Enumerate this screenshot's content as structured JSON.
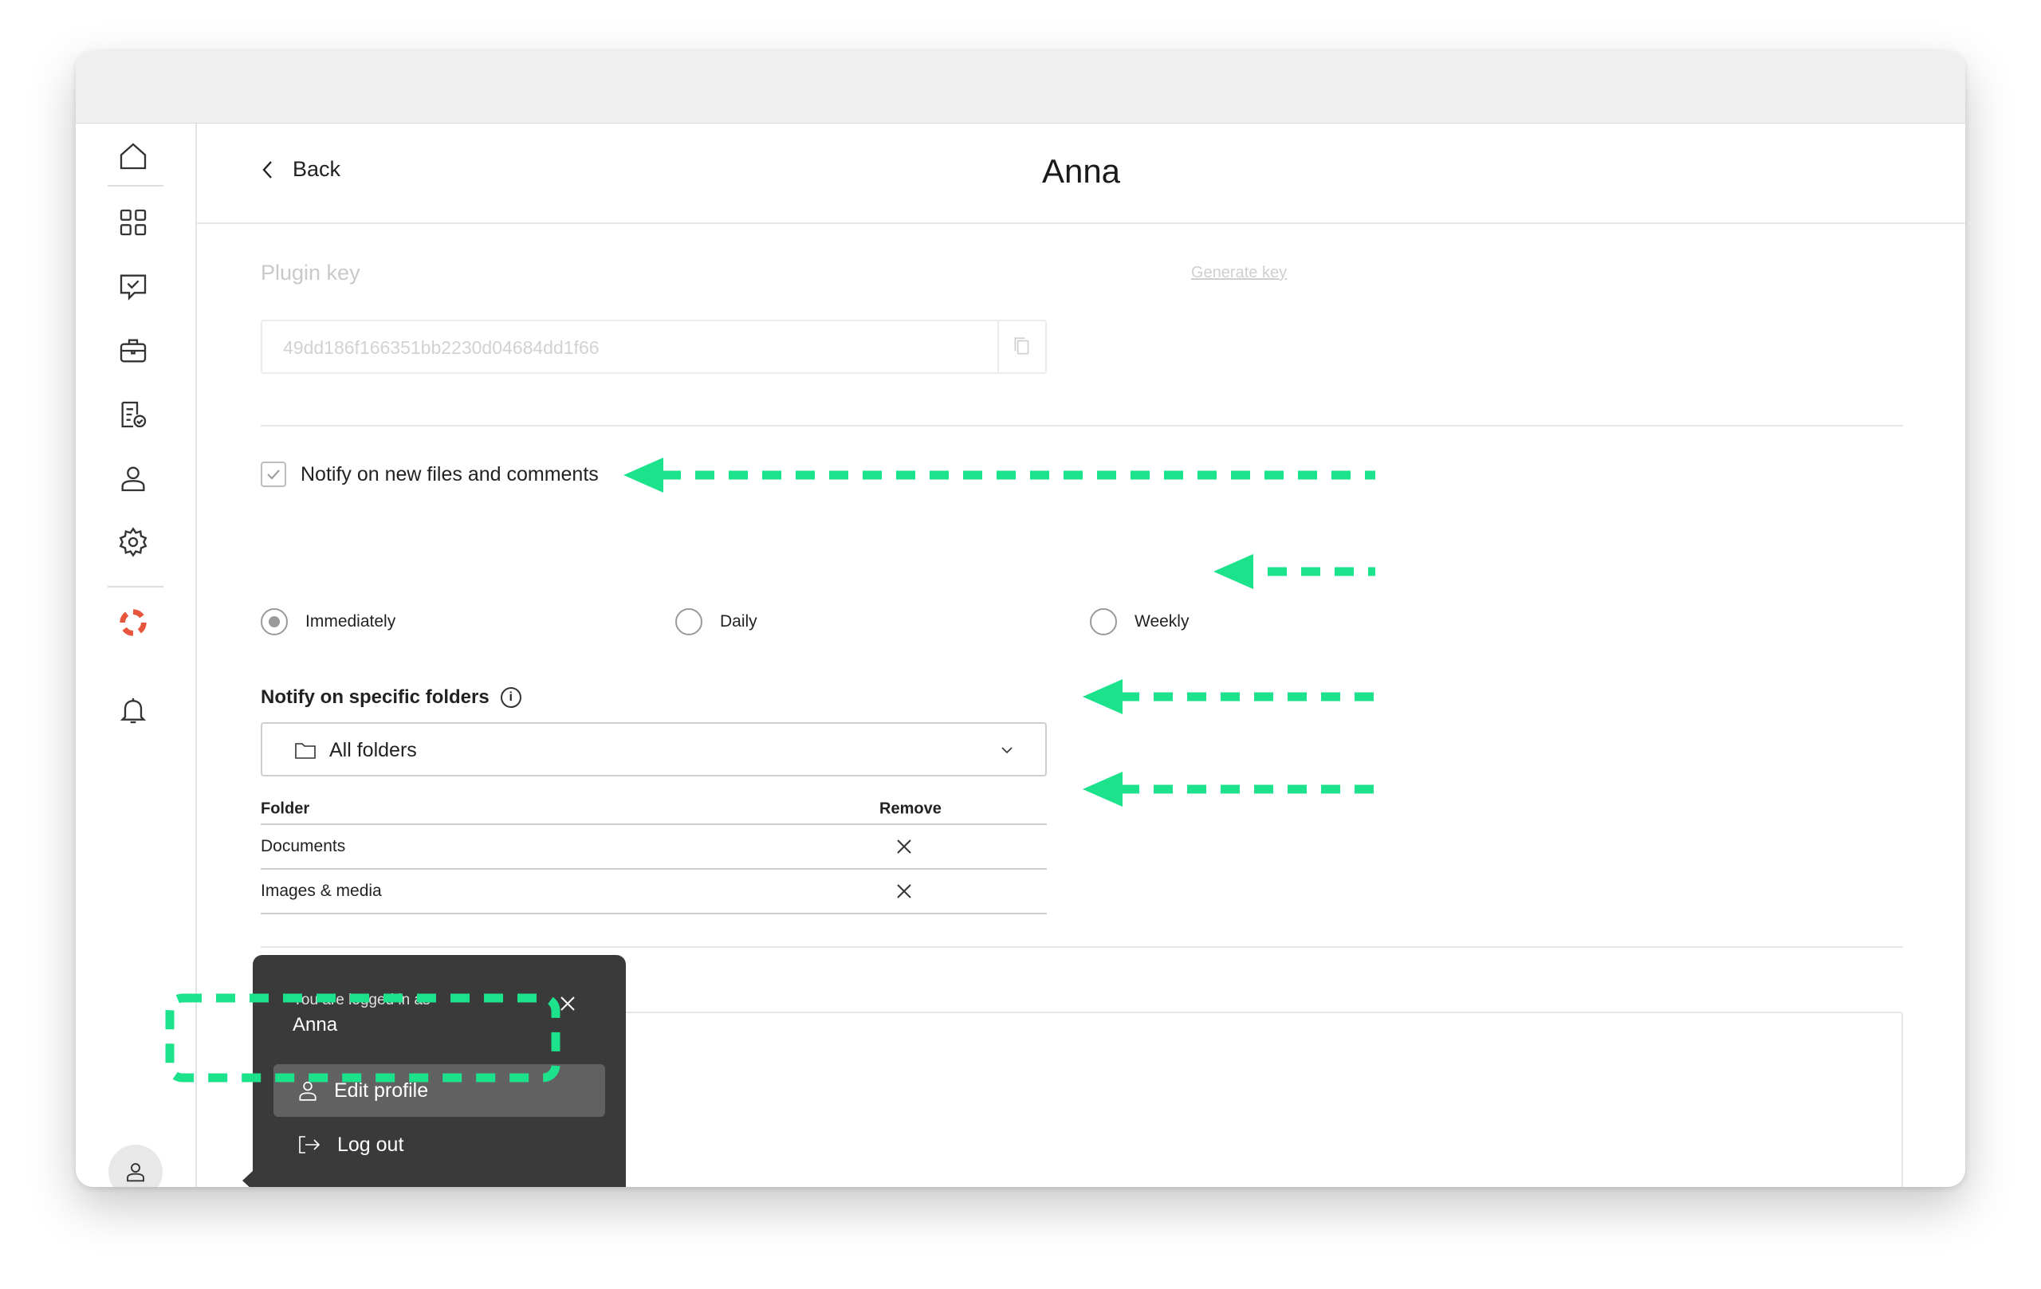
{
  "header": {
    "back_label": "Back",
    "title": "Anna"
  },
  "sidebar": {
    "icons": [
      "home-icon",
      "grid-icon",
      "chat-check-icon",
      "briefcase-icon",
      "document-check-icon",
      "person-icon",
      "gear-icon",
      "lifebuoy-icon",
      "bell-icon",
      "avatar-icon"
    ]
  },
  "plugin": {
    "label": "Plugin key",
    "generate_label": "Generate key",
    "key_value": "49dd186f166351bb2230d04684dd1f66"
  },
  "notify": {
    "checkbox_label": "Notify on new files and comments",
    "checked": true,
    "frequency": [
      {
        "label": "Immediately",
        "selected": true
      },
      {
        "label": "Daily",
        "selected": false
      },
      {
        "label": "Weekly",
        "selected": false
      }
    ]
  },
  "folders": {
    "label": "Notify on specific folders",
    "info_symbol": "i",
    "select_value": "All folders",
    "table": {
      "columns": [
        "Folder",
        "Remove"
      ],
      "rows": [
        {
          "folder": "Documents"
        },
        {
          "folder": "Images & media"
        }
      ]
    }
  },
  "popup": {
    "caption": "You are logged in as",
    "user": "Anna",
    "edit_label": "Edit profile",
    "logout_label": "Log out"
  },
  "colors": {
    "annotation_green": "#1de28c",
    "popup_bg": "#3a3a3a",
    "lifebuoy_red": "#e8553d"
  }
}
